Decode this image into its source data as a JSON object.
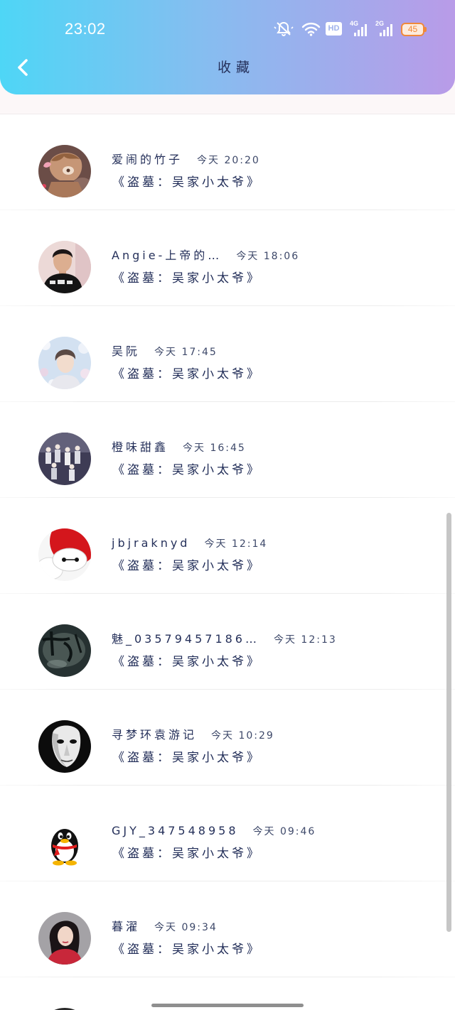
{
  "status_bar": {
    "time": "23:02",
    "hd_label": "HD",
    "network_primary": "4G",
    "network_secondary": "2G",
    "battery_level": "45",
    "icons": [
      "bell-off-icon",
      "wifi-icon",
      "hd-icon",
      "signal-4g-icon",
      "signal-2g-icon",
      "battery-icon"
    ]
  },
  "header": {
    "title": "收藏",
    "back_icon": "chevron-left-icon"
  },
  "colors": {
    "header_gradient_start": "#4ed6f6",
    "header_gradient_end": "#b99be8",
    "text_primary": "#25305a",
    "battery_accent": "#f0893a"
  },
  "favorites": [
    {
      "user_name": "爱闹的竹子",
      "time": "今天 20:20",
      "work_title": "《盗墓：吴家小太爷》"
    },
    {
      "user_name": "Angie-上帝的…",
      "time": "今天 18:06",
      "work_title": "《盗墓：吴家小太爷》"
    },
    {
      "user_name": "吴阮",
      "time": "今天 17:45",
      "work_title": "《盗墓：吴家小太爷》"
    },
    {
      "user_name": "橙味甜鑫",
      "time": "今天 16:45",
      "work_title": "《盗墓：吴家小太爷》"
    },
    {
      "user_name": "jbjraknyd",
      "time": "今天 12:14",
      "work_title": "《盗墓：吴家小太爷》"
    },
    {
      "user_name": "魅_03579457186…",
      "time": "今天 12:13",
      "work_title": "《盗墓：吴家小太爷》"
    },
    {
      "user_name": "寻梦环袁游记",
      "time": "今天 10:29",
      "work_title": "《盗墓：吴家小太爷》"
    },
    {
      "user_name": "GJY_347548958",
      "time": "今天 09:46",
      "work_title": "《盗墓：吴家小太爷》"
    },
    {
      "user_name": "暮濯",
      "time": "今天 09:34",
      "work_title": "《盗墓：吴家小太爷》"
    }
  ]
}
